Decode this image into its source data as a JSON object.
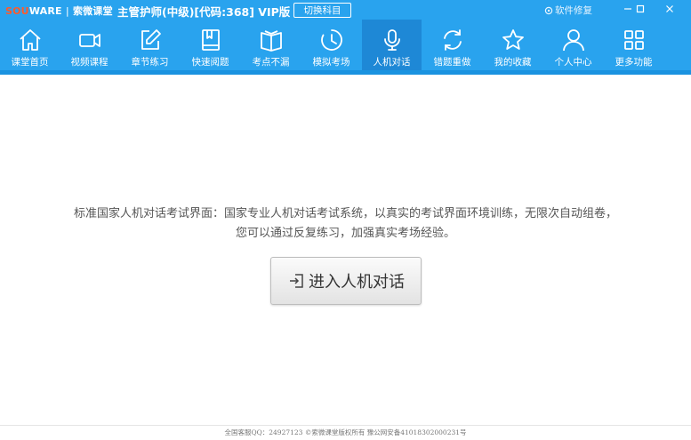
{
  "app": {
    "logo_sou": "SOU",
    "logo_ware": "WARE",
    "logo_cn": "索微课堂",
    "title": "主管护师(中级)[代码:368] VIP版",
    "switch_label": "切换科目",
    "repair_label": "软件修复"
  },
  "nav": {
    "items": [
      {
        "label": "课堂首页",
        "icon": "home-icon"
      },
      {
        "label": "视频课程",
        "icon": "video-camera-icon"
      },
      {
        "label": "章节练习",
        "icon": "edit-pencil-icon"
      },
      {
        "label": "快速阅题",
        "icon": "book-icon"
      },
      {
        "label": "考点不漏",
        "icon": "open-book-icon"
      },
      {
        "label": "模拟考场",
        "icon": "clock-icon"
      },
      {
        "label": "人机对话",
        "icon": "microphone-icon",
        "active": true
      },
      {
        "label": "错题重做",
        "icon": "refresh-icon"
      },
      {
        "label": "我的收藏",
        "icon": "star-icon"
      },
      {
        "label": "个人中心",
        "icon": "user-icon"
      },
      {
        "label": "更多功能",
        "icon": "grid-icon"
      }
    ]
  },
  "main": {
    "description_line1": "标准国家人机对话考试界面：国家专业人机对话考试系统，以真实的考试界面环境训练，无限次自动组卷，",
    "description_line2": "您可以通过反复练习，加强真实考场经验。",
    "enter_label": "进入人机对话"
  },
  "footer": {
    "text": "全国客服QQ：24927123 ©索微课堂版权所有 豫公网安备41018302000231号"
  },
  "colors": {
    "header_bg": "#29a3ee",
    "active_tab_bg": "#1e88d6",
    "logo_accent": "#ff5a2a"
  }
}
